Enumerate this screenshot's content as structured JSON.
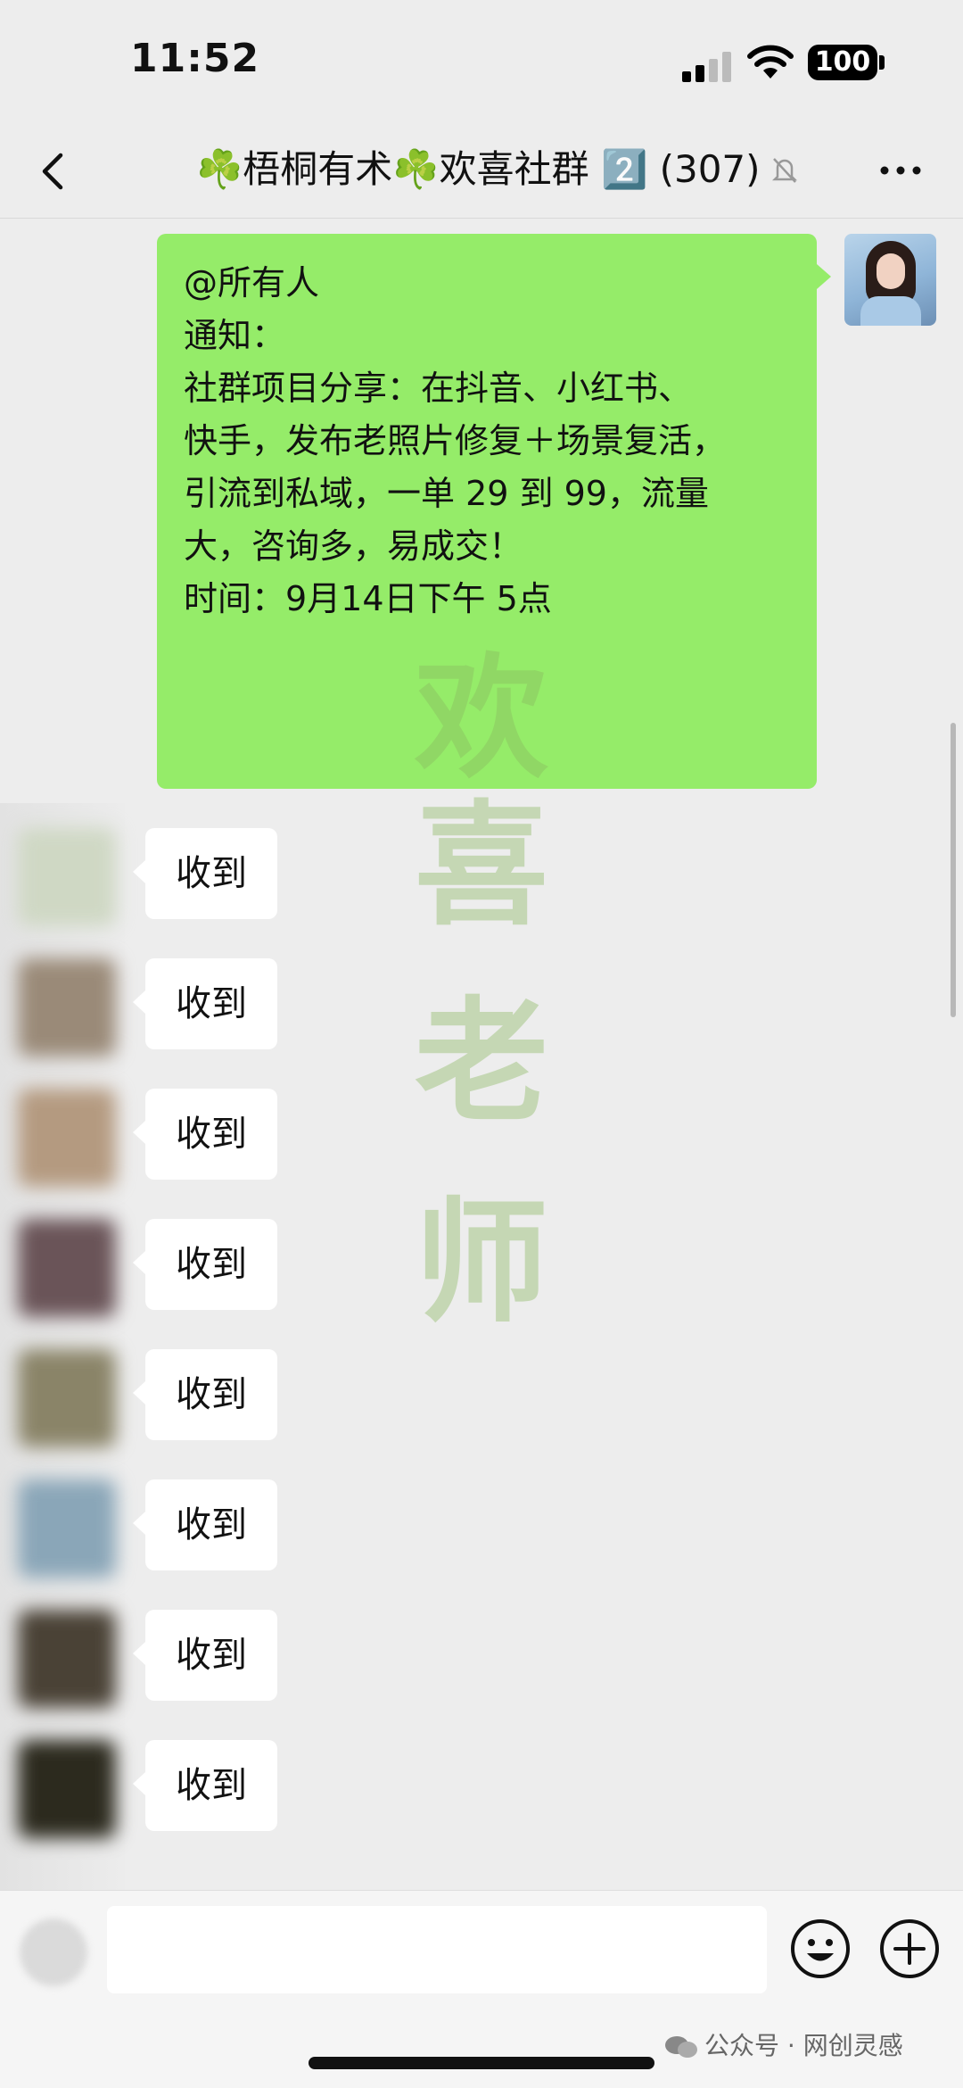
{
  "status_bar": {
    "time": "11:52",
    "battery": "100"
  },
  "nav": {
    "title": "☘️梧桐有术☘️欢喜社群 2️⃣ (307)"
  },
  "message_self": {
    "lines": [
      "@所有人",
      "",
      "通知：",
      "",
      "社群项目分享：在抖音、小红书、",
      "快手，发布老照片修复＋场景复活，",
      "引流到私域，一单 29 到 99，流量",
      "大，咨询多，易成交！",
      "",
      "时间：9月14日下午 5点"
    ]
  },
  "watermark": {
    "chars": [
      "欢",
      "喜",
      "老",
      "师"
    ]
  },
  "replies": [
    {
      "text": "收到",
      "avatar_color": "#cfd8c4"
    },
    {
      "text": "收到",
      "avatar_color": "#9a8a78"
    },
    {
      "text": "收到",
      "avatar_color": "#b49a80"
    },
    {
      "text": "收到",
      "avatar_color": "#6a5458"
    },
    {
      "text": "收到",
      "avatar_color": "#8a8468"
    },
    {
      "text": "收到",
      "avatar_color": "#8aa6b8"
    },
    {
      "text": "收到",
      "avatar_color": "#4a4236"
    },
    {
      "text": "收到",
      "avatar_color": "#2c2a1e"
    }
  ],
  "input": {
    "value": ""
  },
  "credit": {
    "text": "公众号 · 网创灵感"
  },
  "colors": {
    "self_bubble": "#95ec69",
    "background": "#ededed"
  }
}
